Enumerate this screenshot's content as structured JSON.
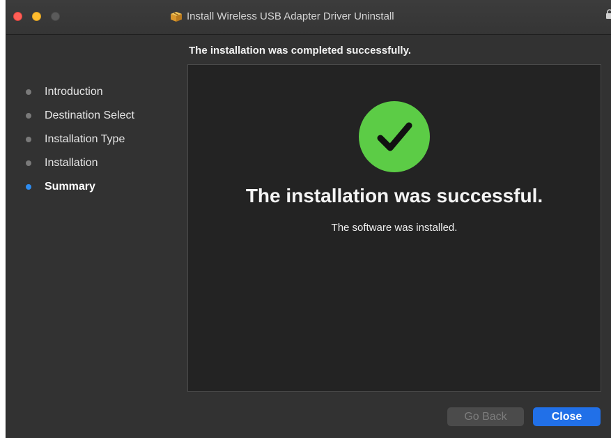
{
  "window": {
    "title": "Install Wireless USB Adapter Driver Uninstall"
  },
  "header": {
    "text": "The installation was completed successfully."
  },
  "sidebar": {
    "steps": [
      {
        "label": "Introduction",
        "active": false
      },
      {
        "label": "Destination Select",
        "active": false
      },
      {
        "label": "Installation Type",
        "active": false
      },
      {
        "label": "Installation",
        "active": false
      },
      {
        "label": "Summary",
        "active": true
      }
    ]
  },
  "main": {
    "icon": "checkmark-icon",
    "title": "The installation was successful.",
    "subtitle": "The software was installed."
  },
  "buttons": {
    "back_label": "Go Back",
    "close_label": "Close"
  },
  "colors": {
    "success_green": "#5ccc46",
    "accent_blue": "#2170e8",
    "active_step_dot": "#2d8cf0"
  }
}
